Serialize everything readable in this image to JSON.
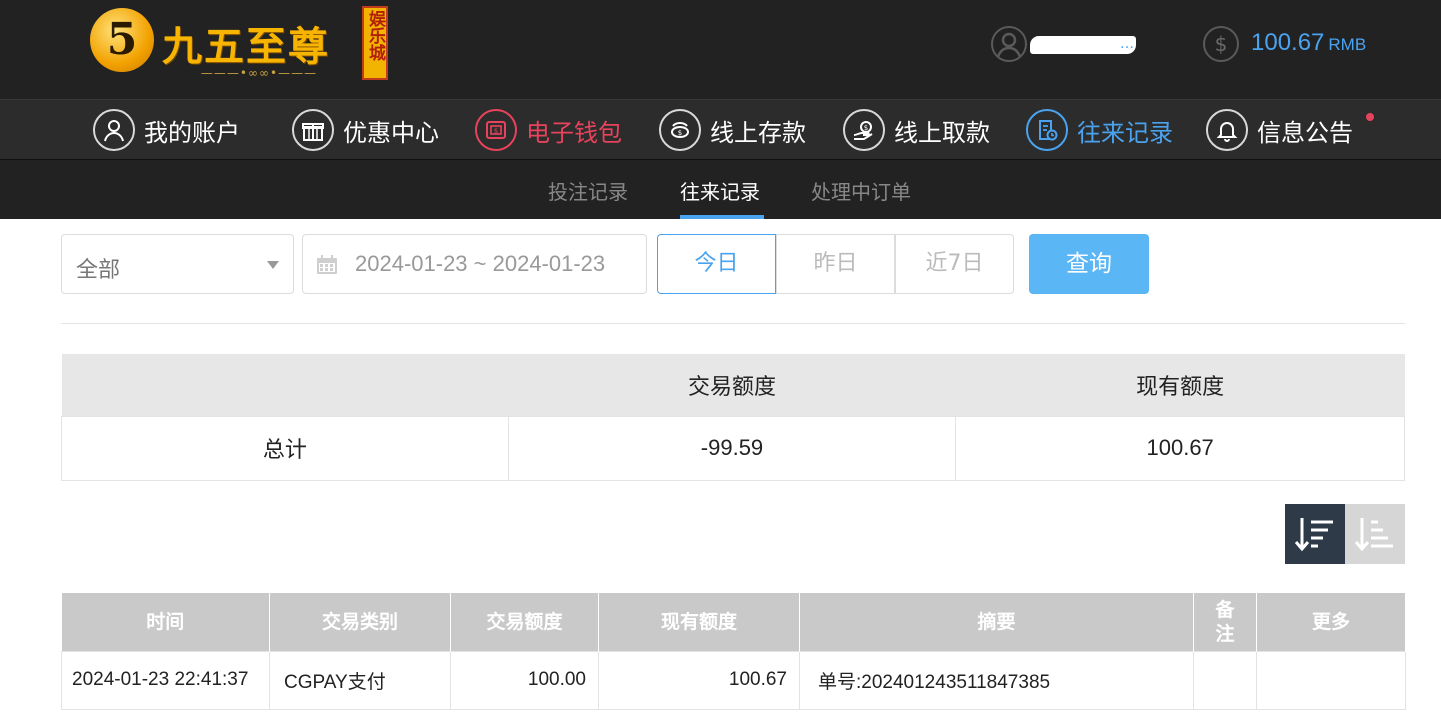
{
  "header": {
    "logo": {
      "digit": "5",
      "name": "九五至尊",
      "badge": "娱乐城"
    },
    "user": {
      "name_visible": "…"
    },
    "balance": {
      "amount": "100.67",
      "currency": "RMB"
    }
  },
  "main_nav": [
    {
      "label": "我的账户",
      "icon": "user-icon",
      "state": "normal"
    },
    {
      "label": "优惠中心",
      "icon": "gift-icon",
      "state": "normal"
    },
    {
      "label": "电子钱包",
      "icon": "wallet-icon",
      "state": "highlight-red"
    },
    {
      "label": "线上存款",
      "icon": "deposit-icon",
      "state": "normal"
    },
    {
      "label": "线上取款",
      "icon": "withdraw-icon",
      "state": "normal"
    },
    {
      "label": "往来记录",
      "icon": "records-icon",
      "state": "active"
    },
    {
      "label": "信息公告",
      "icon": "bell-icon",
      "state": "normal",
      "has_notification": true
    }
  ],
  "sub_nav": [
    {
      "label": "投注记录",
      "active": false
    },
    {
      "label": "往来记录",
      "active": true
    },
    {
      "label": "处理中订单",
      "active": false
    }
  ],
  "filters": {
    "type_select": {
      "value": "全部"
    },
    "date_range": {
      "value": "2024-01-23 ~ 2024-01-23"
    },
    "quick_ranges": [
      {
        "label": "今日",
        "active": true
      },
      {
        "label": "昨日",
        "active": false
      },
      {
        "label": "近7日",
        "active": false
      }
    ],
    "search_label": "查询"
  },
  "summary": {
    "headers": [
      "",
      "交易额度",
      "现有额度"
    ],
    "row": {
      "label": "总计",
      "trade_amount": "-99.59",
      "current_amount": "100.67"
    }
  },
  "sort": {
    "active": "descending"
  },
  "records": {
    "headers": [
      "时间",
      "交易类别",
      "交易额度",
      "现有额度",
      "摘要",
      "备注",
      "更多"
    ],
    "rows": [
      {
        "time": "2024-01-23 22:41:37",
        "category": "CGPAY支付",
        "amount": "100.00",
        "balance": "100.67",
        "summary": "单号:202401243511847385",
        "note": "",
        "more": ""
      }
    ]
  },
  "colors": {
    "header_bg": "#222222",
    "accent_blue": "#4aa3f0",
    "accent_red": "#e8435c",
    "search_button": "#5bb6f5"
  }
}
